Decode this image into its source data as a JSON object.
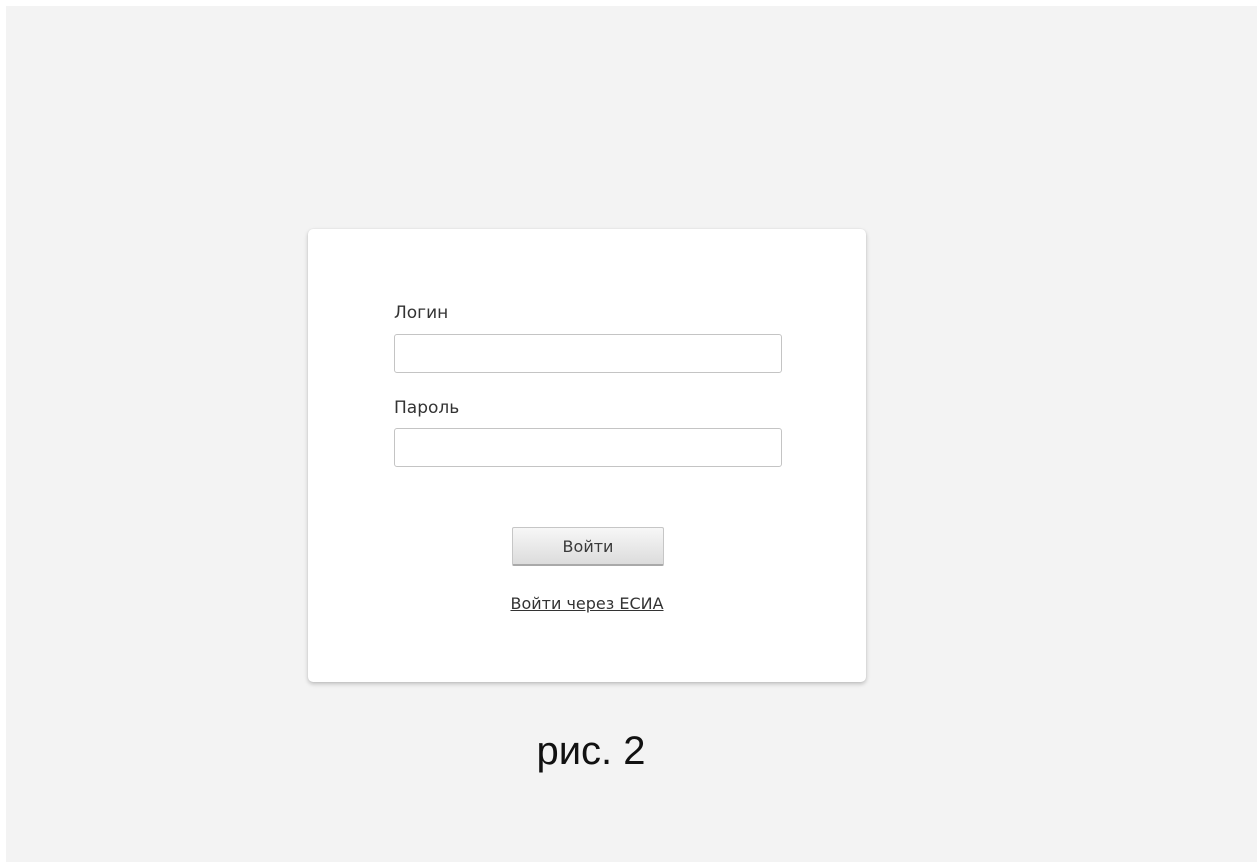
{
  "login_form": {
    "login_label": "Логин",
    "login_value": "",
    "password_label": "Пароль",
    "password_value": "",
    "submit_label": "Войти",
    "esia_link_label": "Войти через ЕСИА"
  },
  "caption": "рис. 2",
  "colors": {
    "page_background": "#f3f3f3",
    "card_background": "#ffffff",
    "text": "#333333"
  }
}
